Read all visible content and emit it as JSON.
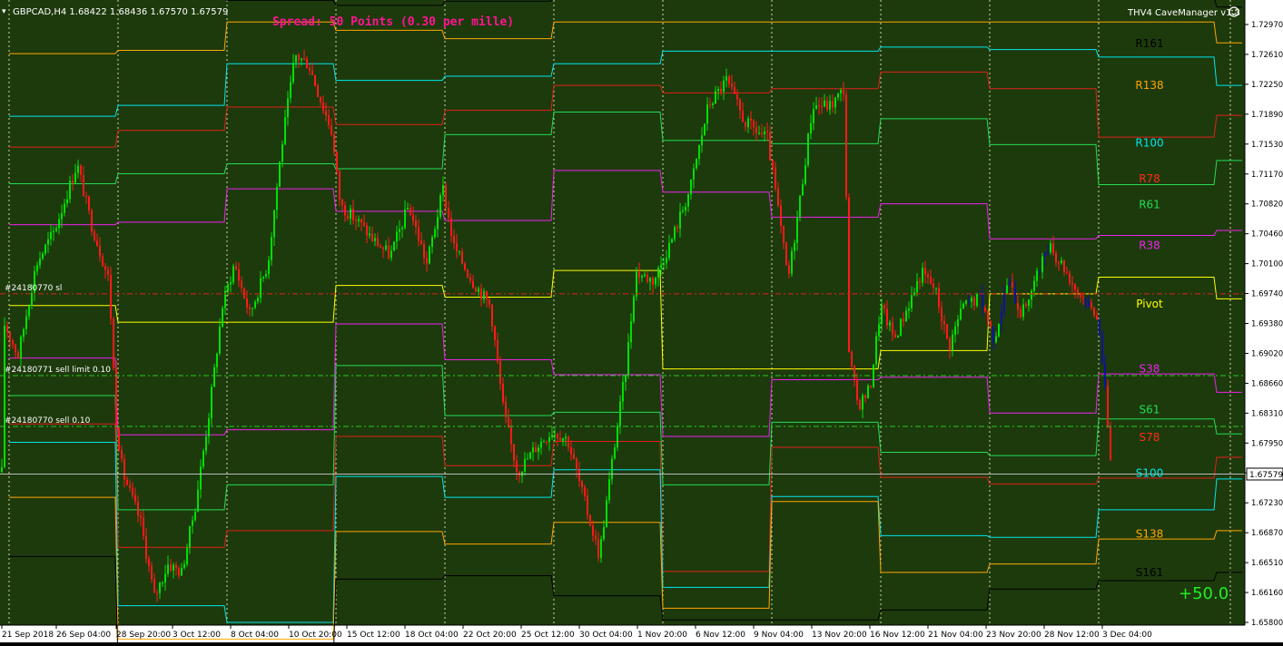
{
  "window": {
    "symbol_info": "GBPCAD,H4  1.68422 1.68436 1.67570 1.67579",
    "spread_text": "Spread: 50 Points (0.30 per mille)",
    "ea_label": "THV4 CaveManager v1.3",
    "profit_text": "+50.0"
  },
  "colors": {
    "background": "#1d3a0c",
    "bull_candle": "#00e000",
    "bear_candle": "#ff1a1a",
    "grid": "#ffffff",
    "axis_text": "#000000",
    "spread_text": "#ff1493",
    "profit_text": "#22ee22"
  },
  "orders": [
    {
      "label": "#24180770 sl",
      "price": 1.6974,
      "color": "#e0201a"
    },
    {
      "label": "#24180771 sell limit 0.10",
      "price": 1.6876,
      "color": "#22cc22"
    },
    {
      "label": "#24180770 sell 0.10",
      "price": 1.6815,
      "color": "#22cc22"
    }
  ],
  "current_price": {
    "label": "1.67579",
    "value": 1.67579
  },
  "level_labels": [
    {
      "name": "R161",
      "price": 1.7274,
      "color": "#000000"
    },
    {
      "name": "R138",
      "price": 1.7224,
      "color": "#ffa500"
    },
    {
      "name": "R100",
      "price": 1.7155,
      "color": "#00e5ee"
    },
    {
      "name": "R78",
      "price": 1.7112,
      "color": "#ff2a1a"
    },
    {
      "name": "R61",
      "price": 1.7081,
      "color": "#22dd55"
    },
    {
      "name": "R38",
      "price": 1.7032,
      "color": "#ee22ee"
    },
    {
      "name": "Pivot",
      "price": 1.6962,
      "color": "#ffff00"
    },
    {
      "name": "S38",
      "price": 1.6884,
      "color": "#ee22ee"
    },
    {
      "name": "S61",
      "price": 1.6835,
      "color": "#22dd55"
    },
    {
      "name": "S78",
      "price": 1.6802,
      "color": "#ff2a1a"
    },
    {
      "name": "S100",
      "price": 1.6759,
      "color": "#00e5ee"
    },
    {
      "name": "S138",
      "price": 1.6686,
      "color": "#ffa500"
    },
    {
      "name": "S161",
      "price": 1.664,
      "color": "#000000"
    }
  ],
  "chart_data": {
    "type": "candlestick",
    "y_axis_ticks": [
      "1.72970",
      "1.72610",
      "1.72250",
      "1.71890",
      "1.71530",
      "1.71170",
      "1.70820",
      "1.70460",
      "1.70100",
      "1.69740",
      "1.69380",
      "1.69020",
      "1.68660",
      "1.68310",
      "1.67950",
      "1.67590",
      "1.67230",
      "1.66870",
      "1.66510",
      "1.66160",
      "1.65800"
    ],
    "x_axis_ticks": [
      "21 Sep 2018",
      "26 Sep 04:00",
      "28 Sep 20:00",
      "3 Oct 12:00",
      "8 Oct 04:00",
      "10 Oct 20:00",
      "15 Oct 12:00",
      "18 Oct 04:00",
      "22 Oct 20:00",
      "25 Oct 12:00",
      "30 Oct 04:00",
      "1 Nov 20:00",
      "6 Nov 12:00",
      "9 Nov 04:00",
      "13 Nov 20:00",
      "16 Nov 12:00",
      "21 Nov 04:00",
      "23 Nov 20:00",
      "28 Nov 12:00",
      "3 Dec 04:00"
    ],
    "y_range": [
      1.658,
      1.7334
    ],
    "weekly_levels": [
      {
        "R161": 1.733,
        "R138": 1.7262,
        "R100": 1.7187,
        "R78": 1.715,
        "R61": 1.7106,
        "R38": 1.7057,
        "Pivot": 1.696,
        "S38": 1.6897,
        "S61": 1.6852,
        "S78": 1.6818,
        "S100": 1.6796,
        "S138": 1.673,
        "S161": 1.6659
      },
      {
        "R161": 1.733,
        "R138": 1.7266,
        "R100": 1.72,
        "R78": 1.717,
        "R61": 1.7118,
        "R38": 1.706,
        "Pivot": 1.694,
        "S38": 1.6805,
        "S61": 1.6715,
        "S78": 1.667,
        "S100": 1.66,
        "S138": 1.656,
        "S161": 1.653
      },
      {
        "R161": 1.7326,
        "R138": 1.73,
        "R100": 1.725,
        "R78": 1.7198,
        "R61": 1.713,
        "R38": 1.71,
        "Pivot": 1.694,
        "S38": 1.6811,
        "S61": 1.6745,
        "S78": 1.669,
        "S100": 1.658,
        "S138": 1.656,
        "S161": 1.653
      },
      {
        "R161": 1.732,
        "R138": 1.729,
        "R100": 1.723,
        "R78": 1.7177,
        "R61": 1.7124,
        "R38": 1.7073,
        "Pivot": 1.6984,
        "S38": 1.6938,
        "S61": 1.6888,
        "S78": 1.6803,
        "S100": 1.6755,
        "S138": 1.6689,
        "S161": 1.6632
      },
      {
        "R161": 1.7325,
        "R138": 1.728,
        "R100": 1.7235,
        "R78": 1.7194,
        "R61": 1.7165,
        "R38": 1.7062,
        "Pivot": 1.697,
        "S38": 1.6895,
        "S61": 1.6828,
        "S78": 1.6768,
        "S100": 1.673,
        "S138": 1.6674,
        "S161": 1.6636
      },
      {
        "R161": 1.733,
        "R138": 1.73,
        "R100": 1.725,
        "R78": 1.7224,
        "R61": 1.7192,
        "R38": 1.7122,
        "Pivot": 1.7002,
        "S38": 1.6877,
        "S61": 1.6832,
        "S78": 1.6797,
        "S100": 1.6763,
        "S138": 1.67,
        "S161": 1.6612
      },
      {
        "R161": 1.7332,
        "R138": 1.73,
        "R100": 1.7265,
        "R78": 1.7215,
        "R61": 1.7158,
        "R38": 1.7096,
        "Pivot": 1.6884,
        "S38": 1.6803,
        "S61": 1.6745,
        "S78": 1.6641,
        "S100": 1.6622,
        "S138": 1.6597,
        "S161": 1.6583
      },
      {
        "R161": 1.7332,
        "R138": 1.73,
        "R100": 1.7265,
        "R78": 1.722,
        "R61": 1.7154,
        "R38": 1.7066,
        "Pivot": 1.6884,
        "S38": 1.6871,
        "S61": 1.682,
        "S78": 1.679,
        "S100": 1.6731,
        "S138": 1.6725,
        "S161": 1.6583
      },
      {
        "R161": 1.733,
        "R138": 1.73,
        "R100": 1.727,
        "R78": 1.724,
        "R61": 1.7184,
        "R38": 1.7082,
        "Pivot": 1.6906,
        "S38": 1.6874,
        "S61": 1.6784,
        "S78": 1.6754,
        "S100": 1.6684,
        "S138": 1.664,
        "S161": 1.6595
      },
      {
        "R161": 1.7328,
        "R138": 1.73,
        "R100": 1.7267,
        "R78": 1.722,
        "R61": 1.7153,
        "R38": 1.704,
        "Pivot": 1.6974,
        "S38": 1.6831,
        "S61": 1.678,
        "S78": 1.6746,
        "S100": 1.6682,
        "S138": 1.665,
        "S161": 1.662
      },
      {
        "R161": 1.733,
        "R138": 1.73,
        "R100": 1.7258,
        "R78": 1.7162,
        "R61": 1.7105,
        "R38": 1.7044,
        "Pivot": 1.6994,
        "S38": 1.6878,
        "S61": 1.6824,
        "S78": 1.6753,
        "S100": 1.6715,
        "S138": 1.668,
        "S161": 1.663
      },
      {
        "R161": 1.7318,
        "R138": 1.7275,
        "R100": 1.7224,
        "R78": 1.7188,
        "R61": 1.7134,
        "R38": 1.705,
        "Pivot": 1.6968,
        "S38": 1.6856,
        "S61": 1.6806,
        "S78": 1.6778,
        "S100": 1.6752,
        "S138": 1.669,
        "S161": 1.664
      }
    ],
    "candle_notes": "Candle bodies approximate the visible price path from 21 Sep 2018 to 3 Dec 2018 (H4)."
  }
}
